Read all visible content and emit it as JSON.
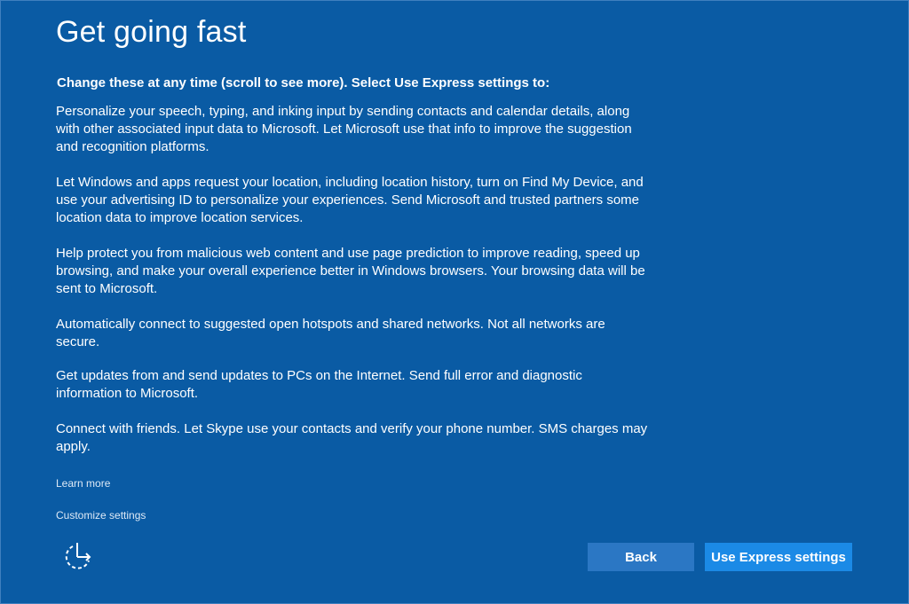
{
  "title": "Get going fast",
  "intro": "Change these at any time (scroll to see more). Select Use Express settings to:",
  "paragraphs": [
    "Personalize your speech, typing, and inking input by sending contacts and calendar details, along with other associated input data to Microsoft. Let Microsoft use that info to improve the suggestion and recognition platforms.",
    "Let Windows and apps request your location, including location history, turn on Find My Device, and use your advertising ID to personalize your experiences. Send Microsoft and trusted partners some location data to improve location services.",
    "Help protect you from malicious web content and use page prediction to improve reading, speed up browsing, and make your overall experience better in Windows browsers. Your browsing data will be sent to Microsoft.",
    "Automatically connect to suggested open hotspots and shared networks. Not all networks are secure.",
    "Get updates from and send updates to PCs on the Internet. Send full error and diagnostic information to Microsoft.",
    "Connect with friends. Let Skype use your contacts and verify your phone number. SMS charges may apply."
  ],
  "links": {
    "learn_more": "Learn more",
    "customize": "Customize settings"
  },
  "buttons": {
    "back": "Back",
    "express": "Use Express settings"
  },
  "icons": {
    "accessibility": "ease-of-access-icon"
  },
  "colors": {
    "background": "#0a5ba4",
    "back_button": "#2b77c4",
    "express_button": "#1b8ae6"
  }
}
